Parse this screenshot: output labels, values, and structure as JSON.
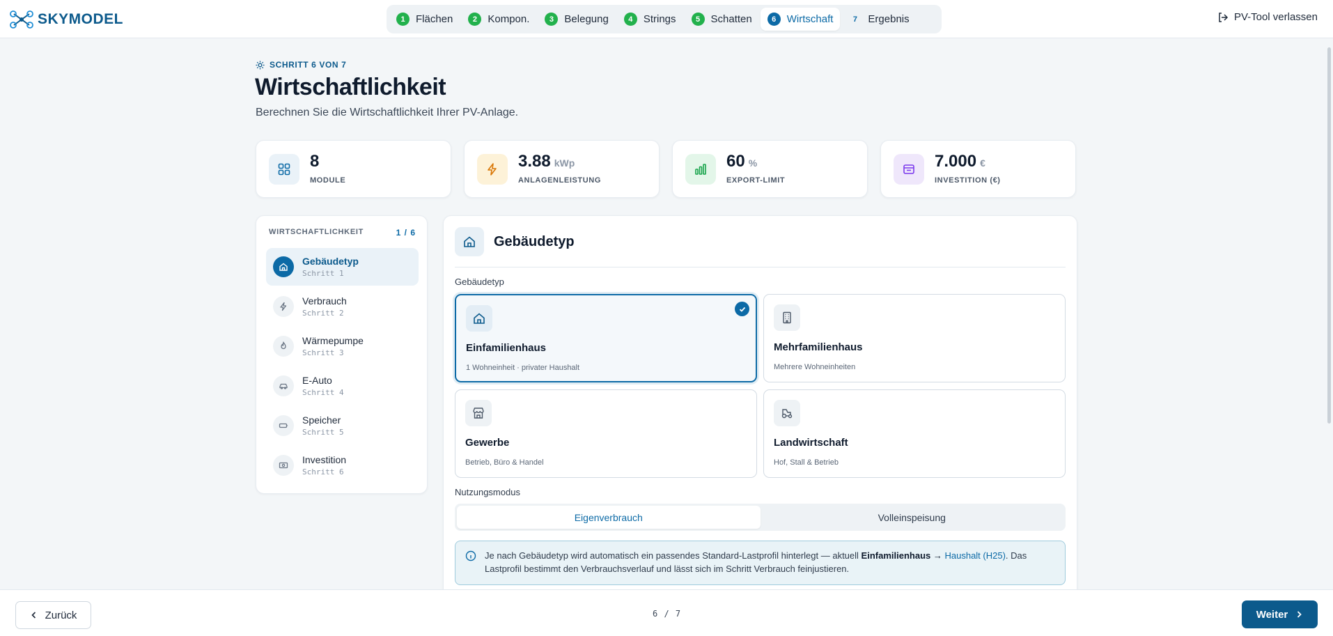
{
  "app": {
    "logo_text": "SKYMODEL",
    "leave_label": "PV-Tool verlassen"
  },
  "steps": [
    {
      "num": "1",
      "label": "Flächen",
      "state": "done"
    },
    {
      "num": "2",
      "label": "Kompon.",
      "state": "done"
    },
    {
      "num": "3",
      "label": "Belegung",
      "state": "done"
    },
    {
      "num": "4",
      "label": "Strings",
      "state": "done"
    },
    {
      "num": "5",
      "label": "Schatten",
      "state": "done"
    },
    {
      "num": "6",
      "label": "Wirtschaft",
      "state": "active"
    },
    {
      "num": "7",
      "label": "Ergebnis",
      "state": "pending"
    }
  ],
  "header": {
    "kicker": "SCHRITT 6 VON 7",
    "title": "Wirtschaftlichkeit",
    "subtitle": "Berechnen Sie die Wirtschaftlichkeit Ihrer PV-Anlage."
  },
  "kpis": [
    {
      "value": "8",
      "unit": "",
      "label": "MODULE",
      "icon": "grid-icon",
      "color": "#0c6aa6",
      "bg": "#eaf2f8"
    },
    {
      "value": "3.88",
      "unit": "kWp",
      "label": "ANLAGENLEISTUNG",
      "icon": "bolt-icon",
      "color": "#d97706",
      "bg": "#fdf2d8"
    },
    {
      "value": "60",
      "unit": "%",
      "label": "EXPORT-LIMIT",
      "icon": "bar-chart-icon",
      "color": "#16a34a",
      "bg": "#e3f6e9"
    },
    {
      "value": "7.000",
      "unit": "€",
      "label": "INVESTITION (€)",
      "icon": "wallet-icon",
      "color": "#7c3aed",
      "bg": "#efe7fb"
    }
  ],
  "sidebar": {
    "title": "WIRTSCHAFTLICHKEIT",
    "count": "1 / 6",
    "items": [
      {
        "label": "Gebäudetyp",
        "sub": "Schritt 1",
        "icon": "home-icon",
        "active": true
      },
      {
        "label": "Verbrauch",
        "sub": "Schritt 2",
        "icon": "bolt-icon",
        "active": false
      },
      {
        "label": "Wärmepumpe",
        "sub": "Schritt 3",
        "icon": "heat-pump-icon",
        "active": false
      },
      {
        "label": "E-Auto",
        "sub": "Schritt 4",
        "icon": "car-icon",
        "active": false
      },
      {
        "label": "Speicher",
        "sub": "Schritt 5",
        "icon": "battery-icon",
        "active": false
      },
      {
        "label": "Investition",
        "sub": "Schritt 6",
        "icon": "money-icon",
        "active": false
      }
    ]
  },
  "main": {
    "title": "Gebäudetyp",
    "field_label": "Gebäudetyp",
    "options": [
      {
        "title": "Einfamilienhaus",
        "sub": "1 Wohneinheit · privater Haushalt",
        "icon": "house-icon",
        "selected": true
      },
      {
        "title": "Mehrfamilienhaus",
        "sub": "Mehrere Wohneinheiten",
        "icon": "building-icon",
        "selected": false
      },
      {
        "title": "Gewerbe",
        "sub": "Betrieb, Büro & Handel",
        "icon": "store-icon",
        "selected": false
      },
      {
        "title": "Landwirtschaft",
        "sub": "Hof, Stall & Betrieb",
        "icon": "tractor-icon",
        "selected": false
      }
    ],
    "mode_label": "Nutzungsmodus",
    "modes": [
      {
        "label": "Eigenverbrauch",
        "active": true
      },
      {
        "label": "Volleinspeisung",
        "active": false
      }
    ],
    "info": {
      "pre": "Je nach Gebäudetyp wird automatisch ein passendes Standard-Lastprofil hinterlegt — aktuell ",
      "bold": "Einfamilienhaus →",
      "link": "Haushalt (H25)",
      "post": ". Das Lastprofil bestimmt den Verbrauchsverlauf und lässt sich im Schritt Verbrauch feinjustieren."
    }
  },
  "footer": {
    "back_label": "Zurück",
    "pager": "6 / 7",
    "next_label": "Weiter"
  }
}
